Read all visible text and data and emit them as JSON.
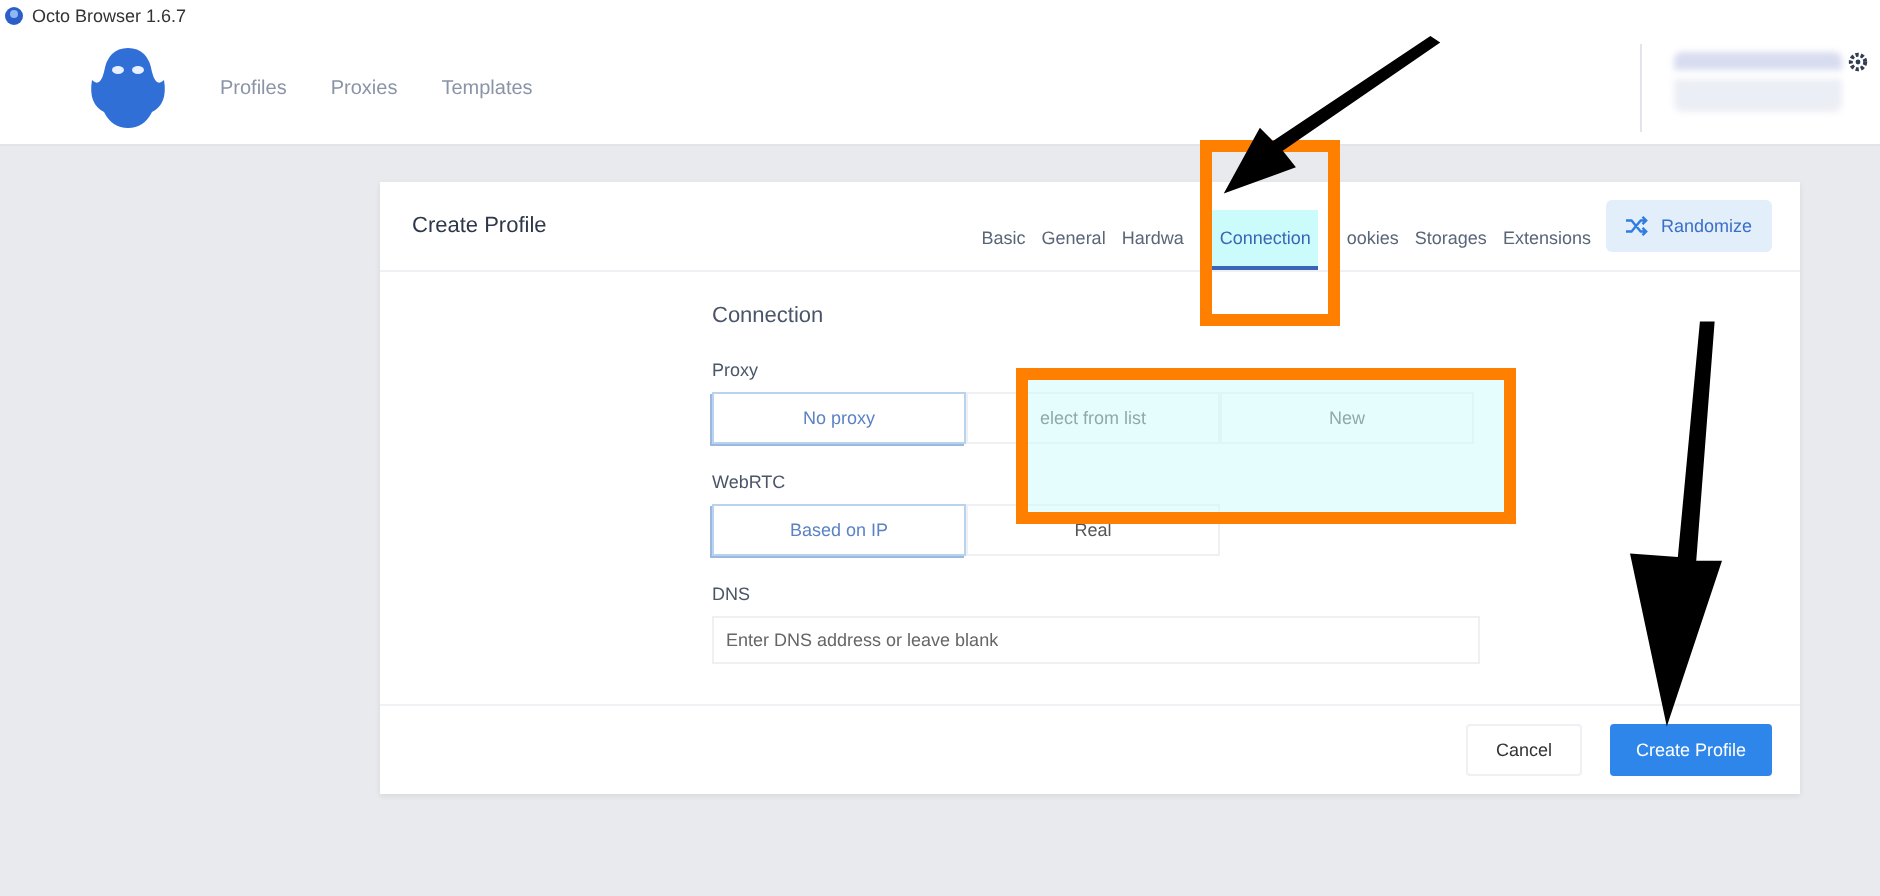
{
  "window": {
    "title": "Octo Browser 1.6.7"
  },
  "nav": [
    {
      "label": "Profiles"
    },
    {
      "label": "Proxies"
    },
    {
      "label": "Templates"
    }
  ],
  "dialog": {
    "title": "Create Profile",
    "tabs": [
      {
        "label": "Basic",
        "selected": false
      },
      {
        "label": "General",
        "selected": false
      },
      {
        "label": "Hardwa",
        "selected": false
      },
      {
        "label": "Connection",
        "selected": true
      },
      {
        "label": "ookies",
        "selected": false
      },
      {
        "label": "Storages",
        "selected": false
      },
      {
        "label": "Extensions",
        "selected": false
      }
    ],
    "randomize": "Randomize",
    "section": "Connection",
    "proxy": {
      "label": "Proxy",
      "options": [
        {
          "label": "No proxy",
          "selected": true
        },
        {
          "label": "elect from list",
          "selected": false
        },
        {
          "label": "New",
          "selected": false
        }
      ]
    },
    "webrtc": {
      "label": "WebRTC",
      "options": [
        {
          "label": "Based on IP",
          "selected": true
        },
        {
          "label": "Real",
          "selected": false
        }
      ]
    },
    "dns": {
      "label": "DNS",
      "placeholder": "Enter DNS address or leave blank"
    },
    "buttons": [
      {
        "label": "Cancel",
        "kind": "secondary"
      },
      {
        "label": "Create Profile",
        "kind": "primary"
      }
    ]
  }
}
